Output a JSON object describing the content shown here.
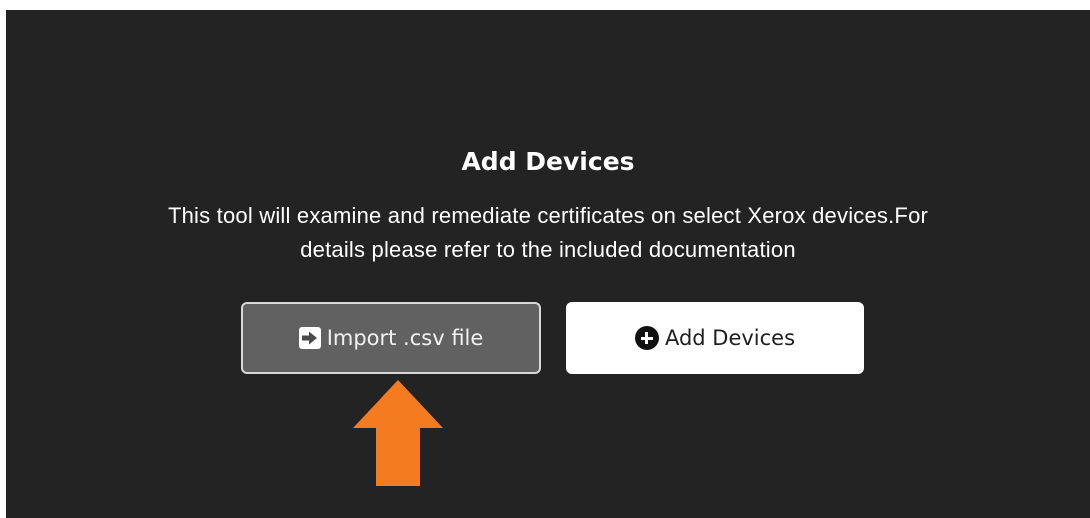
{
  "dialog": {
    "title": "Add Devices",
    "description_line1": "This tool will examine and remediate certificates on select Xerox devices.For",
    "description_line2": "details please refer to the included documentation"
  },
  "buttons": {
    "import": {
      "label": "Import .csv file",
      "icon": "import-icon"
    },
    "add": {
      "label": "Add Devices",
      "icon": "plus-circle-icon"
    }
  },
  "annotation": {
    "icon": "up-arrow-icon",
    "color": "#f47b20"
  },
  "colors": {
    "panel_bg": "#232323",
    "import_button_bg": "#616161",
    "add_button_bg": "#ffffff"
  }
}
